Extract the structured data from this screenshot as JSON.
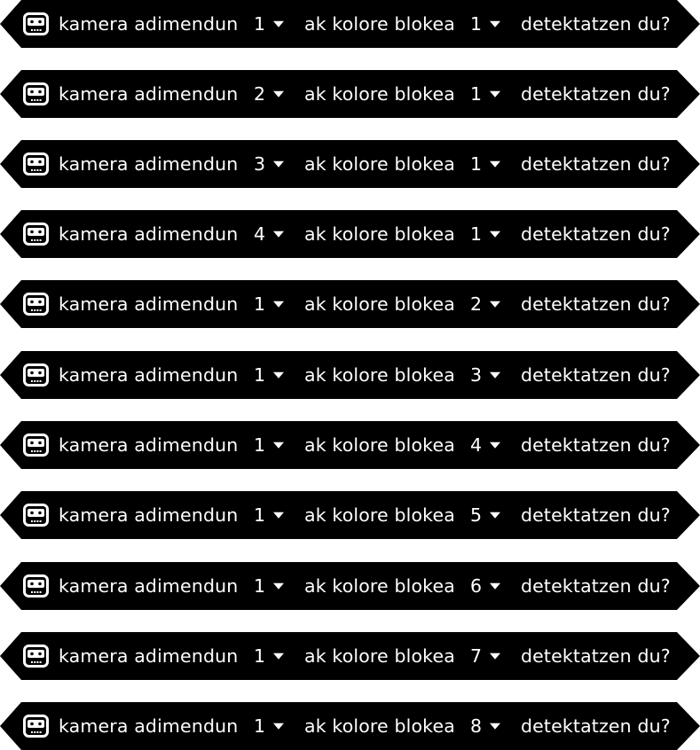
{
  "blocks": [
    {
      "prefix": "kamera adimendun",
      "camera": "1",
      "middle": "ak kolore blokea",
      "color_block": "1",
      "suffix": "detektatzen du?"
    },
    {
      "prefix": "kamera adimendun",
      "camera": "2",
      "middle": "ak kolore blokea",
      "color_block": "1",
      "suffix": "detektatzen du?"
    },
    {
      "prefix": "kamera adimendun",
      "camera": "3",
      "middle": "ak kolore blokea",
      "color_block": "1",
      "suffix": "detektatzen du?"
    },
    {
      "prefix": "kamera adimendun",
      "camera": "4",
      "middle": "ak kolore blokea",
      "color_block": "1",
      "suffix": "detektatzen du?"
    },
    {
      "prefix": "kamera adimendun",
      "camera": "1",
      "middle": "ak kolore blokea",
      "color_block": "2",
      "suffix": "detektatzen du?"
    },
    {
      "prefix": "kamera adimendun",
      "camera": "1",
      "middle": "ak kolore blokea",
      "color_block": "3",
      "suffix": "detektatzen du?"
    },
    {
      "prefix": "kamera adimendun",
      "camera": "1",
      "middle": "ak kolore blokea",
      "color_block": "4",
      "suffix": "detektatzen du?"
    },
    {
      "prefix": "kamera adimendun",
      "camera": "1",
      "middle": "ak kolore blokea",
      "color_block": "5",
      "suffix": "detektatzen du?"
    },
    {
      "prefix": "kamera adimendun",
      "camera": "1",
      "middle": "ak kolore blokea",
      "color_block": "6",
      "suffix": "detektatzen du?"
    },
    {
      "prefix": "kamera adimendun",
      "camera": "1",
      "middle": "ak kolore blokea",
      "color_block": "7",
      "suffix": "detektatzen du?"
    },
    {
      "prefix": "kamera adimendun",
      "camera": "1",
      "middle": "ak kolore blokea",
      "color_block": "8",
      "suffix": "detektatzen du?"
    }
  ],
  "icons": {
    "block_icon": "smart-camera-icon",
    "dropdown_icon": "caret-down-icon"
  },
  "colors": {
    "block_fill": "#000000",
    "block_text": "#ffffff",
    "background": "#ffffff"
  }
}
